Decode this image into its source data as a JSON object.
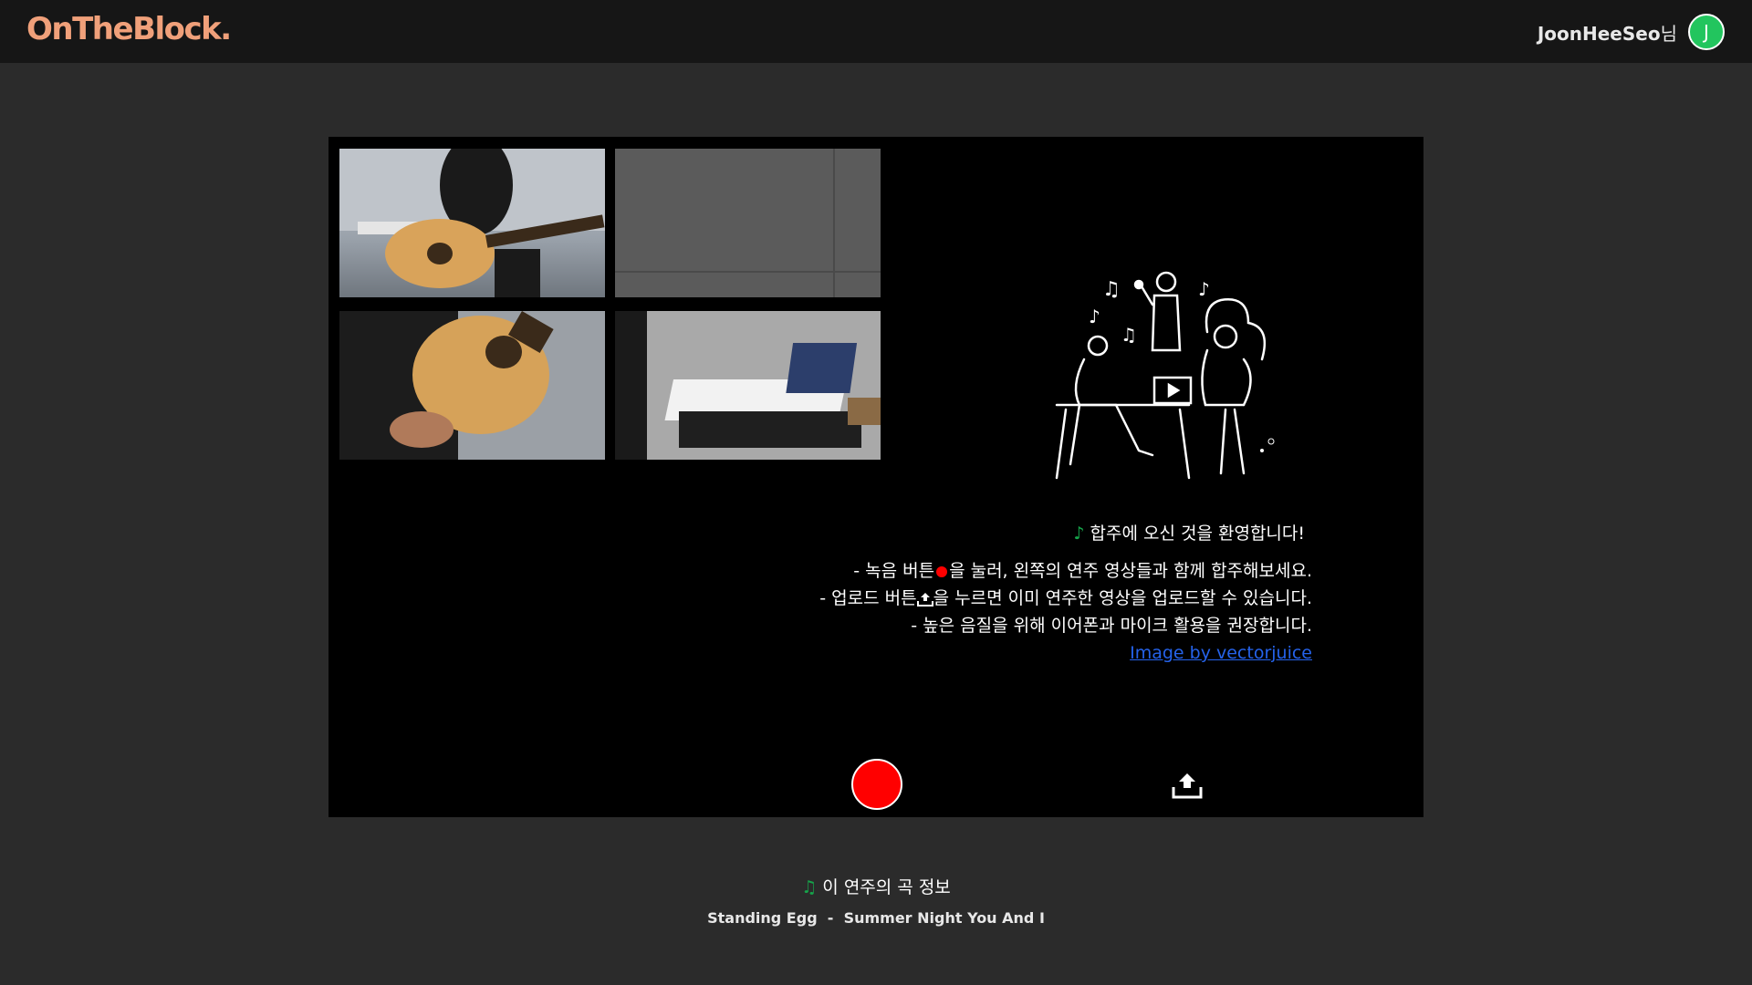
{
  "header": {
    "logo": "OnTheBlock.",
    "user_name": "JoonHeeSeo",
    "user_suffix": "님",
    "avatar_initial": "J",
    "avatar_color": "#22c55e"
  },
  "stage": {
    "video_tiles": [
      {
        "content": "acoustic guitar player"
      },
      {
        "content": "gray wall"
      },
      {
        "content": "acoustic guitar close-up"
      },
      {
        "content": "keyboard and laptop"
      }
    ],
    "welcome": {
      "title": "합주에 오신 것을 환영합니다!",
      "line1_a": "- 녹음 버튼",
      "line1_b": "을 눌러, 왼쪽의 연주 영상들과 함께 합주해보세요.",
      "line2_a": "- 업로드 버튼",
      "line2_b": "을 누르면 이미 연주한 영상을 업로드할 수 있습니다.",
      "line3": "- 높은 음질을 위해 이어폰과 마이크 활용을 권장합니다.",
      "credit_link": "Image by vectorjuice"
    },
    "controls": {
      "record_color": "#ff0000",
      "upload_icon": "upload-tray-icon"
    }
  },
  "song_info": {
    "title": "이 연주의 곡 정보",
    "detail": "Standing Egg  -  Summer Night You And I"
  },
  "colors": {
    "background": "#2b2b2b",
    "topbar": "#161616",
    "logo": "#f0a07a",
    "link": "#2563eb",
    "note": "#16a34a"
  }
}
